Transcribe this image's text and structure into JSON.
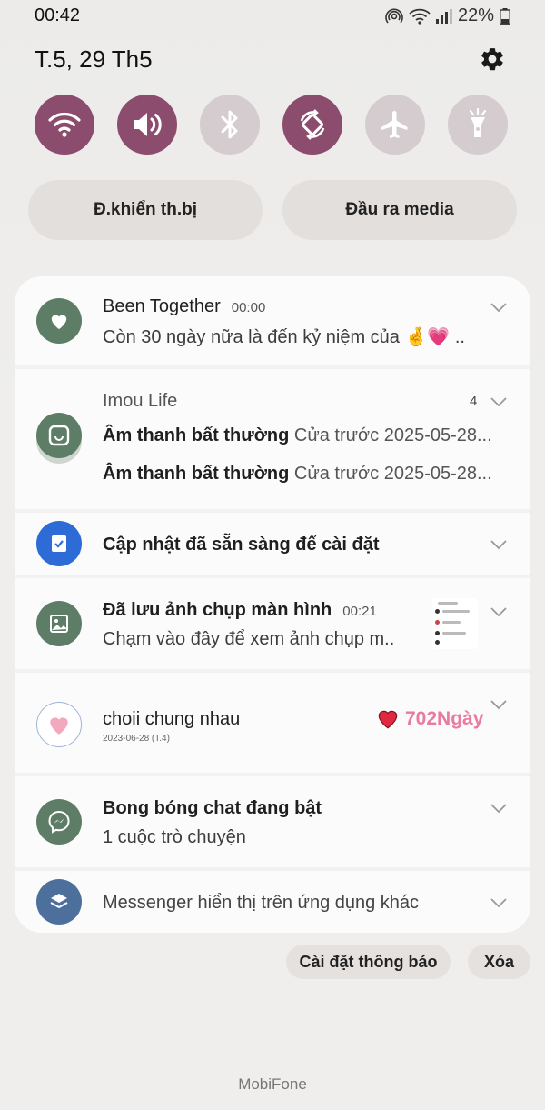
{
  "status": {
    "time": "00:42",
    "battery": "22%"
  },
  "header": {
    "date": "T.5, 29 Th5"
  },
  "toggles": [
    {
      "icon": "wifi-icon",
      "state": "on"
    },
    {
      "icon": "sound-icon",
      "state": "on"
    },
    {
      "icon": "bluetooth-icon",
      "state": "off"
    },
    {
      "icon": "auto-rotate-icon",
      "state": "on"
    },
    {
      "icon": "airplane-icon",
      "state": "off"
    },
    {
      "icon": "flashlight-icon",
      "state": "off"
    }
  ],
  "pills": {
    "device_control": "Đ.khiển th.bị",
    "media_output": "Đầu ra media"
  },
  "notifications": {
    "been_together": {
      "app": "Been Together",
      "time": "00:00",
      "text": "Còn 30 ngày nữa là đến kỷ niệm của 🤞💗 .."
    },
    "imou": {
      "app": "Imou Life",
      "count": "4",
      "rows": [
        {
          "title": "Âm thanh bất thường",
          "detail": "Cửa trước 2025-05-28..."
        },
        {
          "title": "Âm thanh bất thường",
          "detail": "Cửa trước 2025-05-28..."
        }
      ]
    },
    "update": {
      "text": "Cập nhật đã sẵn sàng để cài đặt"
    },
    "screenshot": {
      "title": "Đã lưu ảnh chụp màn hình",
      "time": "00:21",
      "text": "Chạm vào đây để xem ảnh chụp m.."
    },
    "choii": {
      "title": "choii chung nhau",
      "date": "2023-06-28 (T.4)",
      "days": "702Ngày"
    },
    "bubbles": {
      "title": "Bong bóng chat đang bật",
      "text": "1 cuộc trò chuyện"
    },
    "messenger": {
      "text": "Messenger hiển thị trên ứng dụng khác"
    }
  },
  "actions": {
    "notification_settings": "Cài đặt thông báo",
    "clear": "Xóa"
  },
  "carrier": "MobiFone",
  "colors": {
    "toggle_on": "#8b4c6d",
    "toggle_off": "#d5ccd0",
    "app_green": "#5e7d66",
    "update_blue": "#2d6bd6",
    "days_pink": "#e97aa0"
  }
}
